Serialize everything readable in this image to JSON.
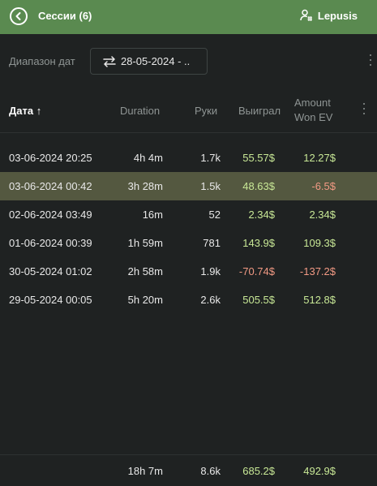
{
  "header": {
    "title": "Сессии (6)",
    "user": "Lepusis"
  },
  "filter": {
    "range_label": "Диапазон дат",
    "range_value": "28-05-2024 - .."
  },
  "table": {
    "columns": {
      "date": "Дата",
      "sort_indicator": "↑",
      "duration": "Duration",
      "hands": "Руки",
      "won": "Выиграл",
      "amount_won_ev_line1": "Amount",
      "amount_won_ev_line2": "Won EV"
    },
    "rows": [
      {
        "date": "03-06-2024 20:25",
        "duration": "4h 4m",
        "hands": "1.7k",
        "won": "55.57$",
        "won_sign": "pos",
        "ev": "12.27$",
        "ev_sign": "pos",
        "selected": false
      },
      {
        "date": "03-06-2024 00:42",
        "duration": "3h 28m",
        "hands": "1.5k",
        "won": "48.63$",
        "won_sign": "pos",
        "ev": "-6.5$",
        "ev_sign": "neg",
        "selected": true
      },
      {
        "date": "02-06-2024 03:49",
        "duration": "16m",
        "hands": "52",
        "won": "2.34$",
        "won_sign": "pos",
        "ev": "2.34$",
        "ev_sign": "pos",
        "selected": false
      },
      {
        "date": "01-06-2024 00:39",
        "duration": "1h 59m",
        "hands": "781",
        "won": "143.9$",
        "won_sign": "pos",
        "ev": "109.3$",
        "ev_sign": "pos",
        "selected": false
      },
      {
        "date": "30-05-2024 01:02",
        "duration": "2h 58m",
        "hands": "1.9k",
        "won": "-70.74$",
        "won_sign": "neg",
        "ev": "-137.2$",
        "ev_sign": "neg",
        "selected": false
      },
      {
        "date": "29-05-2024 00:05",
        "duration": "5h 20m",
        "hands": "2.6k",
        "won": "505.5$",
        "won_sign": "pos",
        "ev": "512.8$",
        "ev_sign": "pos",
        "selected": false
      }
    ],
    "totals": {
      "duration": "18h 7m",
      "hands": "8.6k",
      "won": "685.2$",
      "ev": "492.9$"
    }
  },
  "icons": {
    "back": "back-arrow-circle-icon",
    "user": "user-settings-icon",
    "range": "swap-arrows-icon",
    "menu": "more-vertical-icon"
  },
  "colors": {
    "topbar": "#5a8a50",
    "background": "#1f2222",
    "selected_row": "#545840",
    "positive": "#c8e896",
    "negative": "#f29a84"
  }
}
